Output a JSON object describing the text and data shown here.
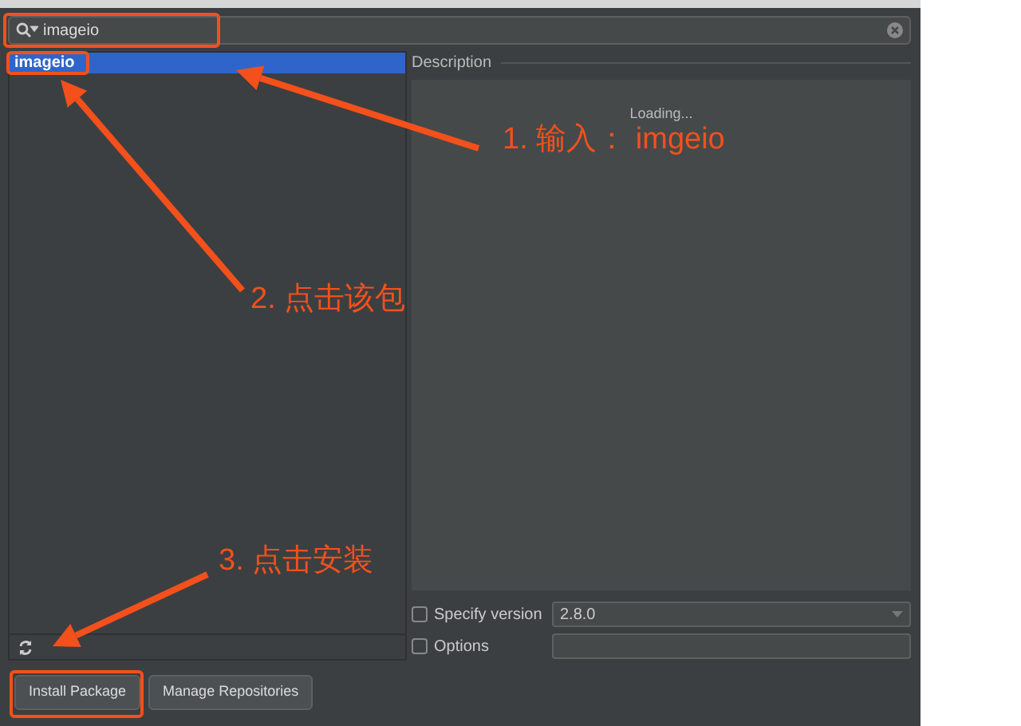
{
  "search": {
    "value": "imageio"
  },
  "packages": [
    {
      "name": "imageio",
      "selected": true
    }
  ],
  "description": {
    "heading": "Description",
    "status": "Loading..."
  },
  "options": [
    {
      "kind": "select",
      "label": "Specify version",
      "checked": false,
      "value": "2.8.0"
    },
    {
      "kind": "text",
      "label": "Options",
      "checked": false
    }
  ],
  "buttons": [
    "Install Package",
    "Manage Repositories"
  ],
  "annotations": [
    {
      "text": "1. 输入： imgeio"
    },
    {
      "text": "2. 点击该包"
    },
    {
      "text": "3. 点击安装"
    }
  ]
}
